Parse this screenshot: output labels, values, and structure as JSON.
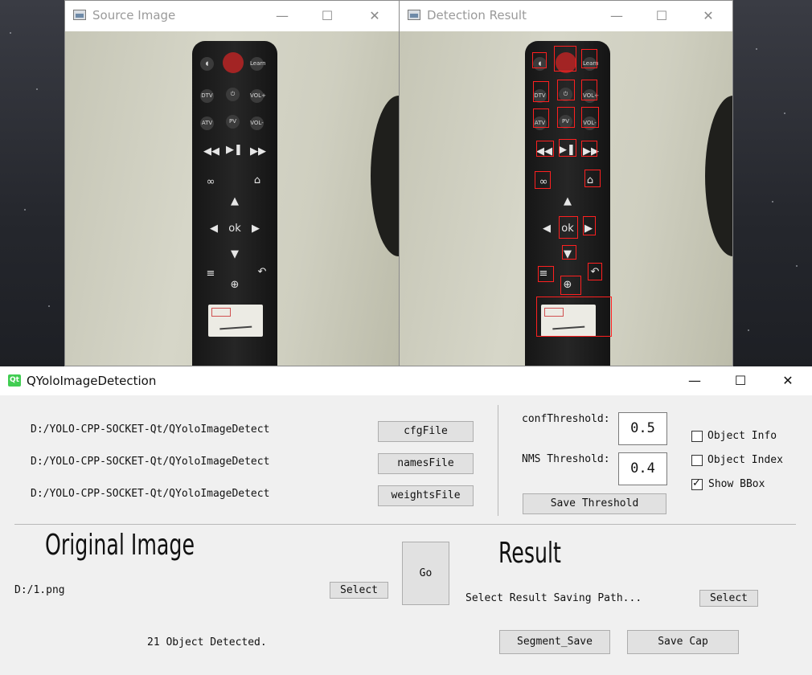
{
  "source_window": {
    "title": "Source Image",
    "controls": {
      "minimize": "—",
      "maximize": "☐",
      "close": "✕"
    },
    "icon": "image-icon"
  },
  "result_window": {
    "title": "Detection Result",
    "controls": {
      "minimize": "—",
      "maximize": "☐",
      "close": "✕"
    },
    "icon": "image-icon"
  },
  "remote": {
    "buttons": [
      "Learn",
      "DTV",
      "VOL+",
      "ATV",
      "VOL-"
    ],
    "ok": "ok"
  },
  "app": {
    "title": "QYoloImageDetection",
    "icon_text": "Qt",
    "controls": {
      "minimize": "—",
      "maximize": "☐",
      "close": "✕"
    },
    "files": [
      {
        "path": "D:/YOLO-CPP-SOCKET-Qt/QYoloImageDetect",
        "button": "cfgFile"
      },
      {
        "path": "D:/YOLO-CPP-SOCKET-Qt/QYoloImageDetect",
        "button": "namesFile"
      },
      {
        "path": "D:/YOLO-CPP-SOCKET-Qt/QYoloImageDetect",
        "button": "weightsFile"
      }
    ],
    "thresholds": {
      "conf_label": "confThreshold:",
      "conf_value": "0.5",
      "nms_label": "NMS Threshold:",
      "nms_value": "0.4",
      "save_button": "Save Threshold"
    },
    "options": [
      {
        "label": "Object Info",
        "checked": false
      },
      {
        "label": "Object Index",
        "checked": false
      },
      {
        "label": "Show BBox",
        "checked": true
      }
    ],
    "original": {
      "heading": "Original Image",
      "path": "D:/1.png",
      "select_button": "Select"
    },
    "go_button": "Go",
    "result": {
      "heading": "Result",
      "path": "Select Result Saving Path...",
      "select_button": "Select"
    },
    "status": "21 Object Detected.",
    "segment_save_button": "Segment_Save",
    "save_cap_button": "Save Cap"
  }
}
